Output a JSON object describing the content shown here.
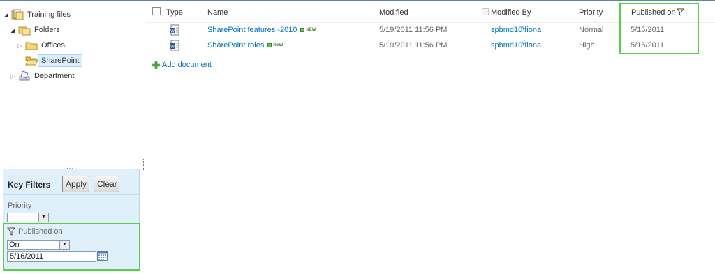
{
  "tree": {
    "root": "Training files",
    "folders": "Folders",
    "offices": "Offices",
    "sharepoint": "SharePoint",
    "department": "Department"
  },
  "splitter_dots": ".....",
  "key_filters": {
    "title": "Key Filters",
    "apply_label": "Apply",
    "clear_label": "Clear",
    "priority_label": "Priority",
    "priority_value": "",
    "published_label": "Published on",
    "operator_value": "On",
    "date_value": "5/16/2011"
  },
  "list": {
    "columns": {
      "type": "Type",
      "name": "Name",
      "modified": "Modified",
      "modified_by": "Modified By",
      "priority": "Priority",
      "published_on": "Published on"
    },
    "rows": [
      {
        "name": "SharePoint features -2010",
        "badge": "NEW",
        "modified": "5/19/2011 11:56 PM",
        "modified_by": "spbmd10\\fiona",
        "priority": "Normal",
        "published_on": "5/15/2011"
      },
      {
        "name": "SharePoint roles",
        "badge": "NEW",
        "modified": "5/19/2011 11:56 PM",
        "modified_by": "spbmd10\\fiona",
        "priority": "High",
        "published_on": "5/15/2011"
      }
    ],
    "add_document": "Add document"
  },
  "colors": {
    "highlight_green": "#57d049",
    "link_blue": "#0072bc",
    "filter_panel_bg": "#dff0fb"
  }
}
